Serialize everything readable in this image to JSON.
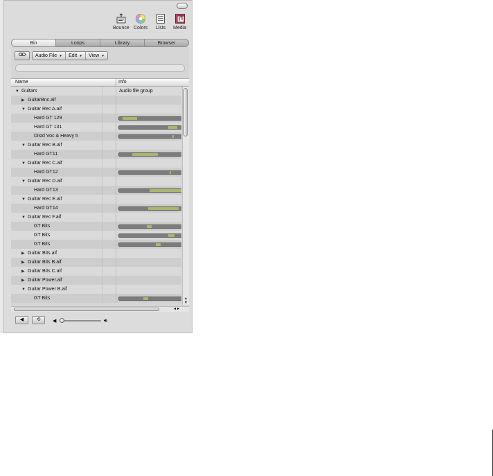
{
  "toolbar": {
    "bounce": "Bounce",
    "colors": "Colors",
    "lists": "Lists",
    "media": "Media"
  },
  "tabs": [
    "Bin",
    "Loops",
    "Library",
    "Browser"
  ],
  "active_tab": 0,
  "controls": {
    "link_icon": "link-icon",
    "audio_file_menu": "Audio File",
    "edit_menu": "Edit",
    "view_menu": "View"
  },
  "table": {
    "col_name": "Name",
    "col_info": "Info",
    "rows": [
      {
        "name": "Guitars",
        "level": 0,
        "tri": "down",
        "info": "Audio file group"
      },
      {
        "name": "GuitarBnc.aif",
        "level": 1,
        "tri": "right"
      },
      {
        "name": "Guitar Rec A.aif",
        "level": 1,
        "tri": "down"
      },
      {
        "name": "Hard GT 129",
        "level": 2,
        "bar": {
          "start": 0.05,
          "end": 0.28
        }
      },
      {
        "name": "Hard GT 131",
        "level": 2,
        "bar": {
          "start": 0.76,
          "end": 0.9
        }
      },
      {
        "name": "Distd Voc & Heavy 5",
        "level": 2,
        "bar": {
          "start": 0.83,
          "end": 0.85
        }
      },
      {
        "name": "Guitar Rec B.aif",
        "level": 1,
        "tri": "down"
      },
      {
        "name": "Hard GT11",
        "level": 2,
        "bar": {
          "start": 0.2,
          "end": 0.6
        }
      },
      {
        "name": "Guitar Rec C.aif",
        "level": 1,
        "tri": "down"
      },
      {
        "name": "Hard GT12",
        "level": 2,
        "bar": {
          "start": 0.79,
          "end": 0.81
        }
      },
      {
        "name": "Guitar Rec D.aif",
        "level": 1,
        "tri": "down"
      },
      {
        "name": "Hard GT13",
        "level": 2,
        "bar": {
          "start": 0.47,
          "end": 0.98
        }
      },
      {
        "name": "Guitar Rec E.aif",
        "level": 1,
        "tri": "down"
      },
      {
        "name": "Hard GT14",
        "level": 2,
        "bar": {
          "start": 0.45,
          "end": 0.92
        }
      },
      {
        "name": "Guitar Rec F.aif",
        "level": 1,
        "tri": "down"
      },
      {
        "name": "GT Bits",
        "level": 2,
        "bar": {
          "start": 0.43,
          "end": 0.5
        }
      },
      {
        "name": "GT Bits",
        "level": 2,
        "bar": {
          "start": 0.76,
          "end": 0.86
        }
      },
      {
        "name": "GT Bits",
        "level": 2,
        "bar": {
          "start": 0.57,
          "end": 0.64
        }
      },
      {
        "name": "Guitar Bits.aif",
        "level": 1,
        "tri": "right"
      },
      {
        "name": "Guitar Bits B.aif",
        "level": 1,
        "tri": "right"
      },
      {
        "name": "Guitar Bits C.aif",
        "level": 1,
        "tri": "right"
      },
      {
        "name": "Guitar Power.aif",
        "level": 1,
        "tri": "right"
      },
      {
        "name": "Guitar Power B.aif",
        "level": 1,
        "tri": "down"
      },
      {
        "name": "GT Bits",
        "level": 2,
        "bar": {
          "start": 0.38,
          "end": 0.46
        }
      }
    ]
  },
  "colors": {
    "panel": "#dcdcdc",
    "bar_bg": "#7c7c7c",
    "bar_fill": "#a9b56d"
  }
}
